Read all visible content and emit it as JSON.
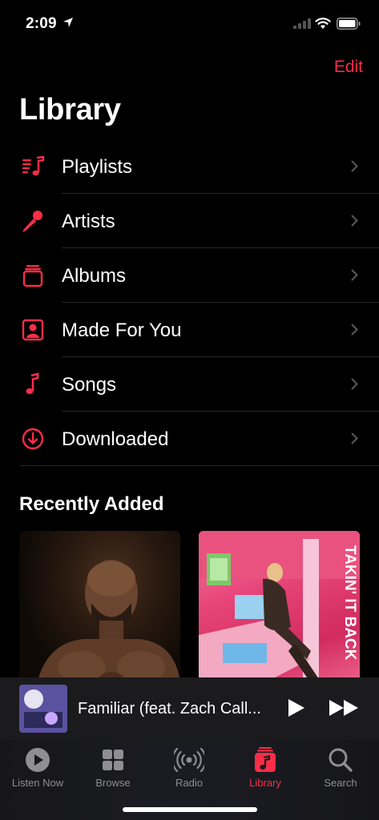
{
  "status": {
    "time": "2:09"
  },
  "header": {
    "edit_label": "Edit",
    "title": "Library"
  },
  "library_items": [
    {
      "label": "Playlists",
      "icon": "playlists-icon"
    },
    {
      "label": "Artists",
      "icon": "microphone-icon"
    },
    {
      "label": "Albums",
      "icon": "albums-icon"
    },
    {
      "label": "Made For You",
      "icon": "person-square-icon"
    },
    {
      "label": "Songs",
      "icon": "music-note-icon"
    },
    {
      "label": "Downloaded",
      "icon": "download-circle-icon"
    }
  ],
  "recently_added": {
    "title": "Recently Added"
  },
  "now_playing": {
    "title": "Familiar (feat. Zach Call..."
  },
  "tabs": [
    {
      "label": "Listen Now",
      "icon": "play-circle-icon",
      "active": false
    },
    {
      "label": "Browse",
      "icon": "grid-icon",
      "active": false
    },
    {
      "label": "Radio",
      "icon": "radio-waves-icon",
      "active": false
    },
    {
      "label": "Library",
      "icon": "library-note-icon",
      "active": true
    },
    {
      "label": "Search",
      "icon": "search-icon",
      "active": false
    }
  ],
  "colors": {
    "accent": "#fa2d48",
    "inactive": "#8e8e93",
    "background": "#000000"
  }
}
